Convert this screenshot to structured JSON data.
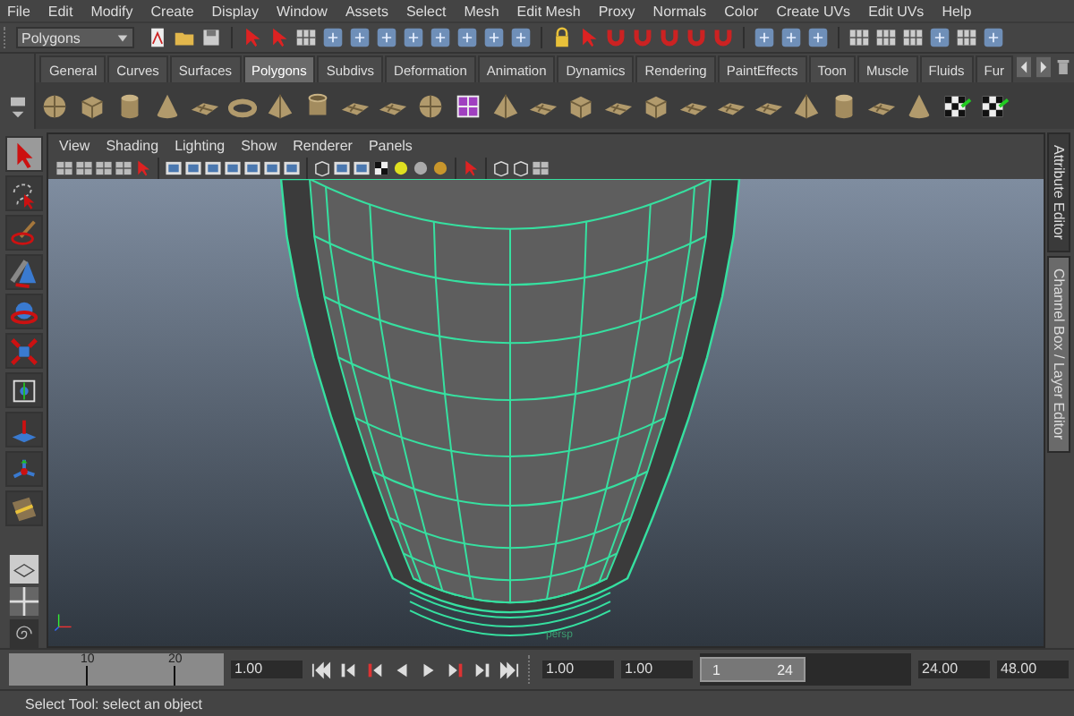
{
  "menu_bar": [
    "File",
    "Edit",
    "Modify",
    "Create",
    "Display",
    "Window",
    "Assets",
    "Select",
    "Mesh",
    "Edit Mesh",
    "Proxy",
    "Normals",
    "Color",
    "Create UVs",
    "Edit UVs",
    "Help"
  ],
  "status_line": {
    "mode_menu": "Polygons"
  },
  "shelf": {
    "tabs": [
      {
        "label": "General",
        "selected": false
      },
      {
        "label": "Curves",
        "selected": false
      },
      {
        "label": "Surfaces",
        "selected": false
      },
      {
        "label": "Polygons",
        "selected": true
      },
      {
        "label": "Subdivs",
        "selected": false
      },
      {
        "label": "Deformation",
        "selected": false
      },
      {
        "label": "Animation",
        "selected": false
      },
      {
        "label": "Dynamics",
        "selected": false
      },
      {
        "label": "Rendering",
        "selected": false
      },
      {
        "label": "PaintEffects",
        "selected": false
      },
      {
        "label": "Toon",
        "selected": false
      },
      {
        "label": "Muscle",
        "selected": false
      },
      {
        "label": "Fluids",
        "selected": false
      },
      {
        "label": "Fur",
        "selected": false
      }
    ]
  },
  "toolbox": {
    "tools": [
      {
        "kind": "select",
        "selected": true
      },
      {
        "kind": "lasso",
        "selected": false
      },
      {
        "kind": "paint",
        "selected": false
      },
      {
        "kind": "move",
        "selected": false
      },
      {
        "kind": "rotate",
        "selected": false
      },
      {
        "kind": "scale",
        "selected": false
      },
      {
        "kind": "universal",
        "selected": false
      },
      {
        "kind": "soft",
        "selected": false
      },
      {
        "kind": "manip",
        "selected": false
      },
      {
        "kind": "last",
        "selected": false
      }
    ]
  },
  "viewport": {
    "menu": [
      "View",
      "Shading",
      "Lighting",
      "Show",
      "Renderer",
      "Panels"
    ],
    "camera_label": "persp"
  },
  "side_tabs": [
    {
      "label": "Attribute Editor",
      "selected": false
    },
    {
      "label": "Channel Box / Layer Editor",
      "selected": true
    }
  ],
  "time_slider": {
    "ticks": [
      "10",
      "20"
    ],
    "current_time": "1.00"
  },
  "range_slider": {
    "level": 0.5,
    "start_time": "1.00",
    "playback_start": "1.00",
    "range_start": "1",
    "range_end": "24",
    "playback_end": "24.00",
    "end_time": "48.00"
  },
  "help_line": "Select Tool: select an object"
}
